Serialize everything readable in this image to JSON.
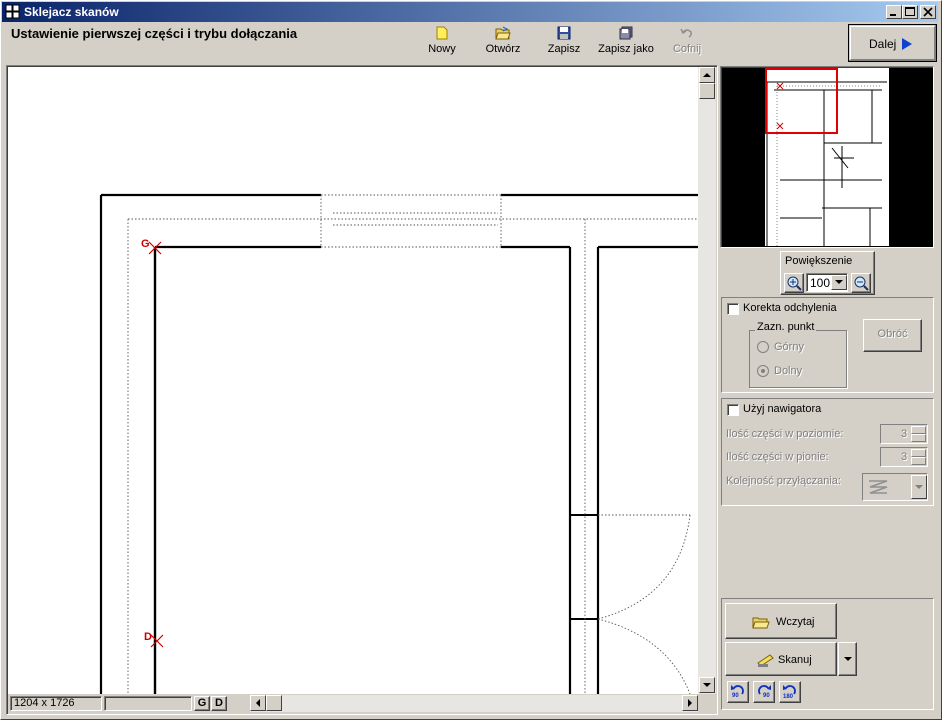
{
  "window": {
    "title": "Sklejacz skanów"
  },
  "header": {
    "heading": "Ustawienie pierwszej części  i trybu dołączania"
  },
  "toolbar": {
    "new_label": "Nowy",
    "open_label": "Otwórz",
    "save_label": "Zapisz",
    "save_as_label": "Zapisz jako",
    "undo_label": "Cofnij",
    "next_label": "Dalej"
  },
  "canvas": {
    "marker_top": "G",
    "marker_bottom": "D"
  },
  "statusbar": {
    "dimensions": "1204 x 1726",
    "g_button": "G",
    "d_button": "D"
  },
  "zoom": {
    "label": "Powiększenie",
    "value": "100"
  },
  "skew": {
    "checkbox_label": "Korekta odchylenia",
    "group_label": "Zazn. punkt",
    "top_label": "Górny",
    "bottom_label": "Dolny",
    "rotate_button": "Obróć"
  },
  "navigator": {
    "checkbox_label": "Użyj nawigatora",
    "horizontal_label": "Ilość części w poziomie:",
    "horizontal_value": "3",
    "vertical_label": "Ilość części w pionie:",
    "vertical_value": "3",
    "order_label": "Kolejność przyłączania:"
  },
  "actions": {
    "load_label": "Wczytaj",
    "scan_label": "Skanuj",
    "rot90l_label": "90",
    "rot90r_label": "90",
    "rot180_label": "180"
  },
  "colors": {
    "title_start": "#0a246a",
    "title_end": "#a6caf0",
    "marker": "#cc0000",
    "preview_frame": "#e00000"
  }
}
